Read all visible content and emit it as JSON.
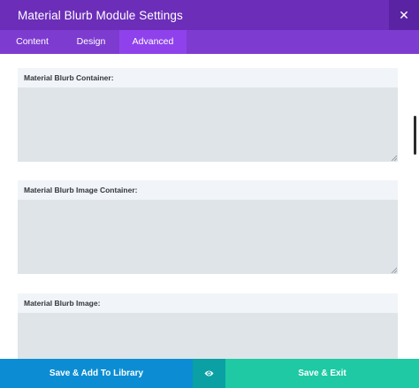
{
  "header": {
    "title": "Material Blurb Module Settings",
    "close_icon": "close-icon",
    "close_glyph": "✕"
  },
  "tabs": [
    {
      "label": "Content",
      "active": false
    },
    {
      "label": "Design",
      "active": false
    },
    {
      "label": "Advanced",
      "active": true
    }
  ],
  "fields": [
    {
      "label": "Material Blurb Container:",
      "value": ""
    },
    {
      "label": "Material Blurb Image Container:",
      "value": ""
    },
    {
      "label": "Material Blurb Image:",
      "value": ""
    }
  ],
  "footer": {
    "save_library_label": "Save & Add To Library",
    "preview_icon": "eye-icon",
    "save_exit_label": "Save & Exit"
  },
  "colors": {
    "header": "#6c2eb9",
    "tabs": "#7e3bd0",
    "active_tab": "#8f42ec",
    "save_library": "#0c8dd3",
    "preview": "#0aa0a4",
    "save_exit": "#1ec9a3"
  }
}
